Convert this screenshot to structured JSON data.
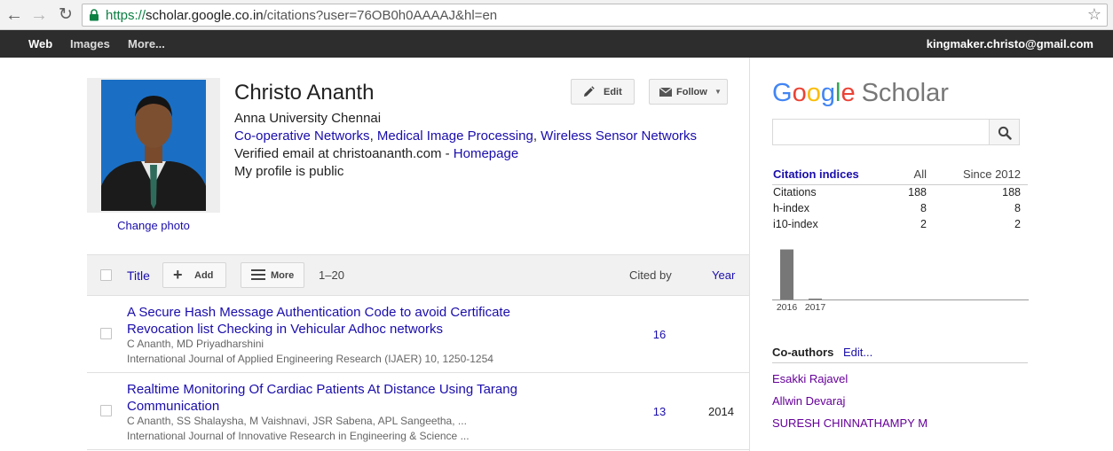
{
  "browser": {
    "url_scheme": "https://",
    "url_host": "scholar.google.co.in",
    "url_path": "/citations?user=76OB0h0AAAAJ&hl=en"
  },
  "gbar": {
    "web": "Web",
    "images": "Images",
    "more": "More...",
    "account": "kingmaker.christo@gmail.com"
  },
  "profile": {
    "name": "Christo Ananth",
    "change_photo": "Change photo",
    "affiliation": "Anna University Chennai",
    "interests": [
      "Co-operative Networks",
      "Medical Image Processing",
      "Wireless Sensor Networks"
    ],
    "interest_sep": ", ",
    "verified_email": "Verified email at christoananth.com - ",
    "homepage": "Homepage",
    "visibility": "My profile is public",
    "edit_label": "Edit",
    "follow_label": "Follow"
  },
  "table": {
    "title_header": "Title",
    "add_label": "Add",
    "more_label": "More",
    "range": "1–20",
    "cited_by_header": "Cited by",
    "year_header": "Year",
    "articles": [
      {
        "title": "A Secure Hash Message Authentication Code to avoid Certificate Revocation list Checking in Vehicular Adhoc networks",
        "authors": "C Ananth, MD Priyadharshini",
        "venue": "International Journal of Applied Engineering Research (IJAER) 10, 1250-1254",
        "cited_by": "16",
        "year": ""
      },
      {
        "title": "Realtime Monitoring Of Cardiac Patients At Distance Using Tarang Communication",
        "authors": "C Ananth, SS Shalaysha, M Vaishnavi, JSR Sabena, APL Sangeetha, ...",
        "venue": "International Journal of Innovative Research in Engineering & Science ...",
        "cited_by": "13",
        "year": "2014"
      }
    ]
  },
  "sidebar": {
    "logo_google": "Google",
    "logo_scholar": "Scholar",
    "colors": {
      "G": "#4285f4",
      "o1": "#ea4335",
      "o2": "#fbbc05",
      "g": "#4285f4",
      "l": "#34a853",
      "e": "#ea4335",
      "bar": "#777777"
    },
    "citation_indices": {
      "header": "Citation indices",
      "col_all": "All",
      "col_since": "Since 2012",
      "rows": [
        {
          "label": "Citations",
          "all": "188",
          "since": "188"
        },
        {
          "label": "h-index",
          "all": "8",
          "since": "8"
        },
        {
          "label": "i10-index",
          "all": "2",
          "since": "2"
        }
      ]
    },
    "coauthors_header": "Co-authors",
    "coauthors_edit": "Edit...",
    "coauthors": [
      "Esakki Rajavel",
      "Allwin Devaraj",
      "SURESH CHINNATHAMPY M"
    ]
  },
  "chart_data": {
    "type": "bar",
    "categories": [
      "2016",
      "2017"
    ],
    "values": [
      185,
      3
    ],
    "title": "",
    "xlabel": "",
    "ylabel": "",
    "ylim": [
      0,
      190
    ]
  }
}
